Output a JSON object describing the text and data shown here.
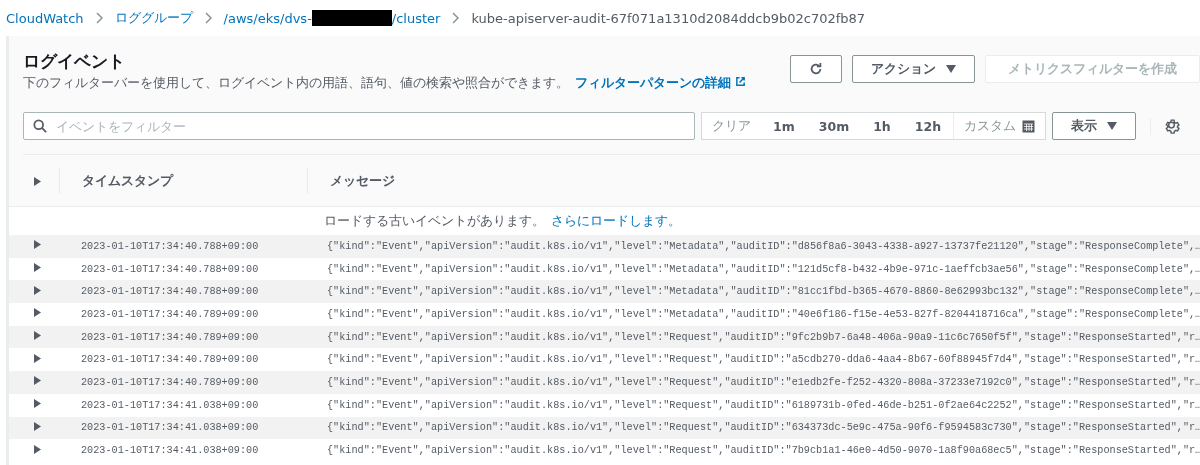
{
  "breadcrumb": [
    {
      "kind": "link",
      "text": "CloudWatch"
    },
    {
      "kind": "link",
      "text": "ロググループ"
    },
    {
      "kind": "redacted",
      "prefix": "/aws/eks/dvs-",
      "suffix": "/cluster"
    },
    {
      "kind": "current",
      "text": "kube-apiserver-audit-67f071a1310d2084ddcb9b02c702fb87"
    }
  ],
  "panel": {
    "title": "ログイベント",
    "description": "下のフィルターバーを使用して、ログイベント内の用語、語句、値の検索や照合ができます。",
    "help_link": "フィルターパターンの詳細"
  },
  "actions": {
    "action_button": "アクション",
    "metric_button": {
      "label": "メトリクスフィルターを作成",
      "disabled": true
    }
  },
  "filter": {
    "placeholder": "イベントをフィルター",
    "ranges": [
      {
        "kind": "clear",
        "label": "クリア"
      },
      {
        "kind": "range",
        "label": "1m"
      },
      {
        "kind": "range",
        "label": "30m"
      },
      {
        "kind": "range",
        "label": "1h"
      },
      {
        "kind": "range",
        "label": "12h"
      },
      {
        "kind": "custom",
        "label": "カスタム"
      }
    ],
    "display_button": "表示"
  },
  "table": {
    "columns": [
      "タイムスタンプ",
      "メッセージ"
    ],
    "load_more": {
      "text": "ロードする古いイベントがあります。",
      "link": "さらにロードします。"
    },
    "rows": [
      {
        "timestamp": "2023-01-10T17:34:40.788+09:00",
        "message": "{\"kind\":\"Event\",\"apiVersion\":\"audit.k8s.io/v1\",\"level\":\"Metadata\",\"auditID\":\"d856f8a6-3043-4338-a927-13737fe21120\",\"stage\":\"ResponseComplete\",…",
        "expanded": false
      },
      {
        "timestamp": "2023-01-10T17:34:40.788+09:00",
        "message": "{\"kind\":\"Event\",\"apiVersion\":\"audit.k8s.io/v1\",\"level\":\"Metadata\",\"auditID\":\"121d5cf8-b432-4b9e-971c-1aeffcb3ae56\",\"stage\":\"ResponseComplete\",…",
        "expanded": false
      },
      {
        "timestamp": "2023-01-10T17:34:40.788+09:00",
        "message": "{\"kind\":\"Event\",\"apiVersion\":\"audit.k8s.io/v1\",\"level\":\"Metadata\",\"auditID\":\"81cc1fbd-b365-4670-8860-8e62993bc132\",\"stage\":\"ResponseComplete\",…",
        "expanded": false
      },
      {
        "timestamp": "2023-01-10T17:34:40.789+09:00",
        "message": "{\"kind\":\"Event\",\"apiVersion\":\"audit.k8s.io/v1\",\"level\":\"Metadata\",\"auditID\":\"40e6f186-f15e-4e53-827f-8204418716ca\",\"stage\":\"ResponseComplete\",…",
        "expanded": false
      },
      {
        "timestamp": "2023-01-10T17:34:40.789+09:00",
        "message": "{\"kind\":\"Event\",\"apiVersion\":\"audit.k8s.io/v1\",\"level\":\"Request\",\"auditID\":\"9fc2b9b7-6a48-406a-90a9-11c6c7650f5f\",\"stage\":\"ResponseStarted\",\"r…",
        "expanded": false
      },
      {
        "timestamp": "2023-01-10T17:34:40.789+09:00",
        "message": "{\"kind\":\"Event\",\"apiVersion\":\"audit.k8s.io/v1\",\"level\":\"Request\",\"auditID\":\"a5cdb270-dda6-4aa4-8b67-60f88945f7d4\",\"stage\":\"ResponseStarted\",\"r…",
        "expanded": false
      },
      {
        "timestamp": "2023-01-10T17:34:40.789+09:00",
        "message": "{\"kind\":\"Event\",\"apiVersion\":\"audit.k8s.io/v1\",\"level\":\"Request\",\"auditID\":\"e1edb2fe-f252-4320-808a-37233e7192c0\",\"stage\":\"ResponseStarted\",\"r…",
        "expanded": false
      },
      {
        "timestamp": "2023-01-10T17:34:41.038+09:00",
        "message": "{\"kind\":\"Event\",\"apiVersion\":\"audit.k8s.io/v1\",\"level\":\"Request\",\"auditID\":\"6189731b-0fed-46de-b251-0f2ae64c2252\",\"stage\":\"ResponseStarted\",\"r…",
        "expanded": false
      },
      {
        "timestamp": "2023-01-10T17:34:41.038+09:00",
        "message": "{\"kind\":\"Event\",\"apiVersion\":\"audit.k8s.io/v1\",\"level\":\"Request\",\"auditID\":\"634373dc-5e9c-475a-90f6-f9594583c730\",\"stage\":\"ResponseStarted\",\"r…",
        "expanded": false
      },
      {
        "timestamp": "2023-01-10T17:34:41.038+09:00",
        "message": "{\"kind\":\"Event\",\"apiVersion\":\"audit.k8s.io/v1\",\"level\":\"Request\",\"auditID\":\"7b9cb1a1-46e0-4d50-9070-1a8f90a68ec5\",\"stage\":\"ResponseStarted\",\"r…",
        "expanded": false
      }
    ]
  }
}
